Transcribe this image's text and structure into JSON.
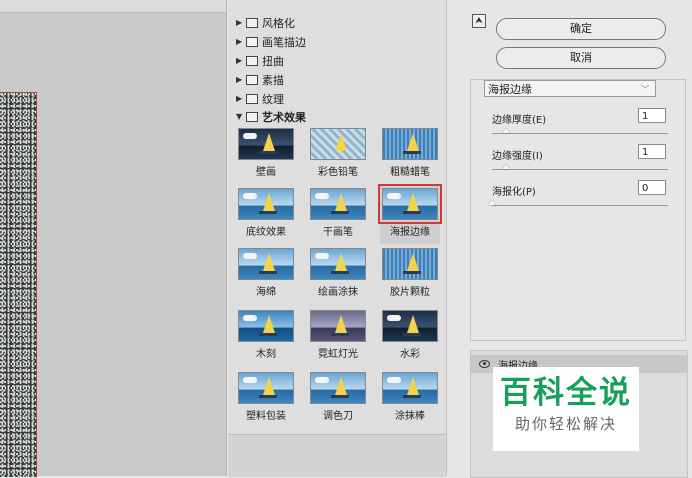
{
  "filter_folders": [
    {
      "label": "风格化",
      "expanded": false
    },
    {
      "label": "画笔描边",
      "expanded": false
    },
    {
      "label": "扭曲",
      "expanded": false
    },
    {
      "label": "素描",
      "expanded": false
    },
    {
      "label": "纹理",
      "expanded": false
    },
    {
      "label": "艺术效果",
      "expanded": true
    }
  ],
  "filters": [
    {
      "label": "壁画"
    },
    {
      "label": "彩色铅笔"
    },
    {
      "label": "粗糙蜡笔"
    },
    {
      "label": "底纹效果"
    },
    {
      "label": "干画笔"
    },
    {
      "label": "海报边缘",
      "selected": true
    },
    {
      "label": "海绵"
    },
    {
      "label": "绘画涂抹"
    },
    {
      "label": "胶片颗粒"
    },
    {
      "label": "木刻"
    },
    {
      "label": "霓虹灯光"
    },
    {
      "label": "水彩"
    },
    {
      "label": "塑料包装"
    },
    {
      "label": "调色刀"
    },
    {
      "label": "涂抹棒"
    }
  ],
  "buttons": {
    "ok": "确定",
    "cancel": "取消"
  },
  "filter_select": {
    "value": "海报边缘"
  },
  "params": [
    {
      "label": "边缘厚度(E)",
      "value": "1",
      "slider_fraction": 0.08
    },
    {
      "label": "边缘强度(I)",
      "value": "1",
      "slider_fraction": 0.08
    },
    {
      "label": "海报化(P)",
      "value": "0",
      "slider_fraction": 0.0
    }
  ],
  "layer": {
    "name": "海报边缘"
  },
  "watermark": {
    "line1": "百科全说",
    "line2": "助你轻松解决"
  },
  "icons": {
    "collapse": "collapse-arrows-icon",
    "eye": "eye-icon",
    "folder": "folder-icon"
  }
}
